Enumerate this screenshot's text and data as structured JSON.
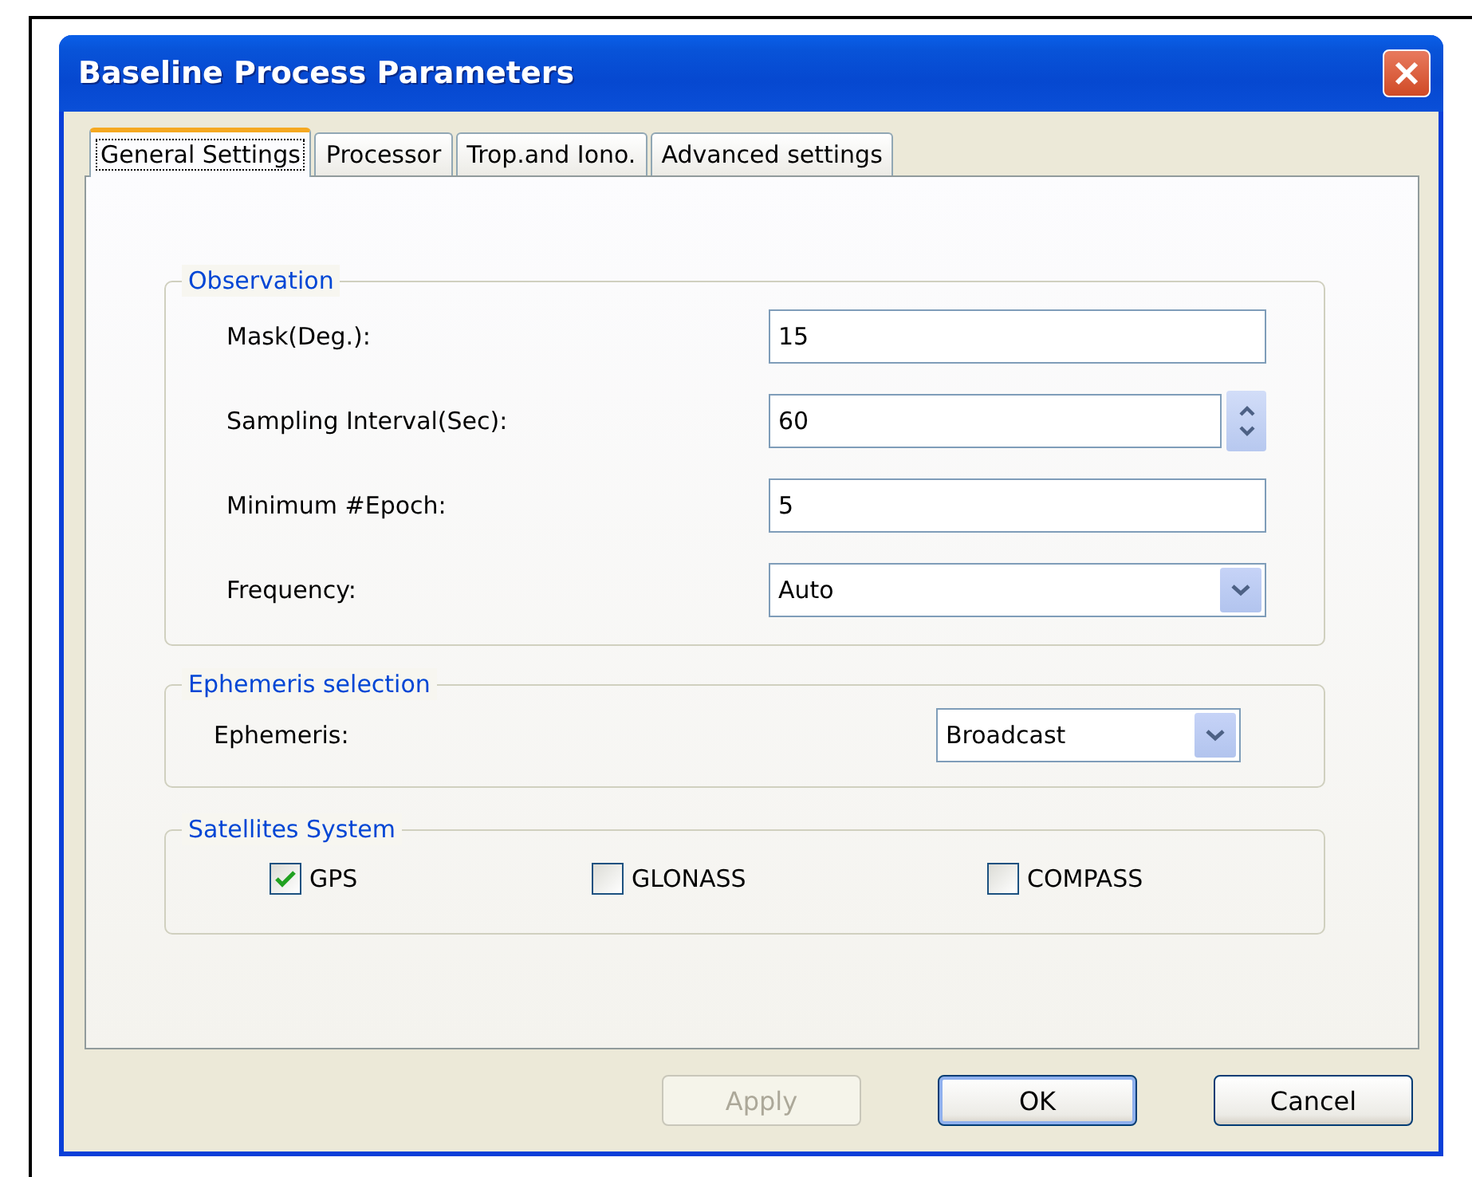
{
  "window": {
    "title": "Baseline Process Parameters"
  },
  "tabs": [
    {
      "label": "General Settings",
      "selected": true
    },
    {
      "label": "Processor",
      "selected": false
    },
    {
      "label": "Trop.and Iono.",
      "selected": false
    },
    {
      "label": "Advanced settings",
      "selected": false
    }
  ],
  "groups": [
    {
      "title": "Observation",
      "kind": "form",
      "fields": [
        {
          "label": "Mask(Deg.):",
          "kind": "text",
          "value": "15"
        },
        {
          "label": "Sampling Interval(Sec):",
          "kind": "spin",
          "value": "60"
        },
        {
          "label": "Minimum #Epoch:",
          "kind": "text",
          "value": "5"
        },
        {
          "label": "Frequency:",
          "kind": "combo",
          "value": "Auto"
        }
      ]
    },
    {
      "title": "Ephemeris selection",
      "kind": "compact",
      "fields": [
        {
          "label": "Ephemeris:",
          "kind": "combo",
          "value": "Broadcast"
        }
      ]
    },
    {
      "title": "Satellites System",
      "kind": "checks",
      "checkboxes": [
        {
          "label": "GPS",
          "checked": true
        },
        {
          "label": "GLONASS",
          "checked": false
        },
        {
          "label": "COMPASS",
          "checked": false
        }
      ]
    }
  ],
  "buttons": [
    {
      "label": "Apply",
      "disabled": true,
      "default": false
    },
    {
      "label": "OK",
      "disabled": false,
      "default": true
    },
    {
      "label": "Cancel",
      "disabled": false,
      "default": false
    }
  ]
}
